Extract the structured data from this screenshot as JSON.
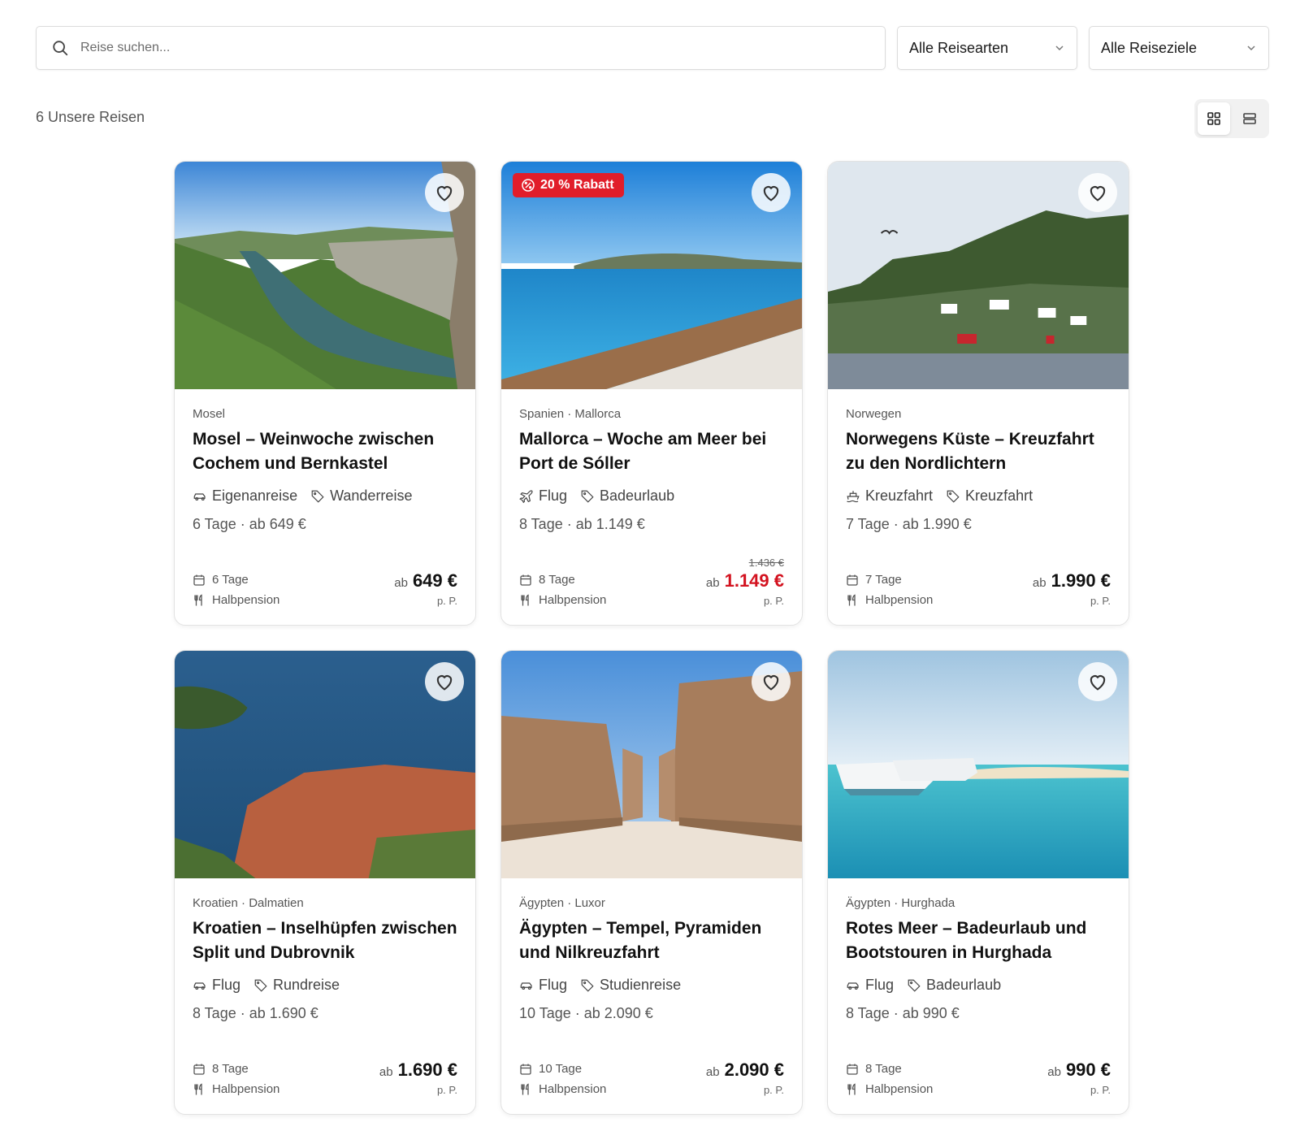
{
  "search": {
    "placeholder": "Reise suchen..."
  },
  "filters": {
    "type_label": "Alle Reisearten",
    "destination_label": "Alle Reiseziele"
  },
  "result_count": "6 Unsere Reisen",
  "view_modes": {
    "active": "grid",
    "options": [
      "grid-icon",
      "list-icon"
    ]
  },
  "colors": {
    "sale": "#d3121f",
    "badge": "#e11d2a",
    "border": "#e2e2e2"
  },
  "trips": [
    {
      "region": "Mosel",
      "title": "Mosel – Weinwoche zwischen Cochem und Bernkastel",
      "transport_icon": "car-icon",
      "transport": "Eigenanreise",
      "category": "Wanderreise",
      "summary": "6 Tage · ab 649 €",
      "duration": "6 Tage",
      "board": "Halbpension",
      "price_prefix": "ab",
      "price": "649 €",
      "old_price": "",
      "per_person": "p. P.",
      "badge": "",
      "image": "river-valley"
    },
    {
      "region": "Spanien · Mallorca",
      "title": "Mallorca – Woche am Meer bei Port de Sóller",
      "transport_icon": "plane-icon",
      "transport": "Flug",
      "category": "Badeurlaub",
      "summary": "8 Tage · ab 1.149 €",
      "duration": "8 Tage",
      "board": "Halbpension",
      "price_prefix": "ab",
      "price": "1.149 €",
      "old_price": "1.436 €",
      "per_person": "p. P.",
      "badge": "20 % Rabatt",
      "image": "bay"
    },
    {
      "region": "Norwegen",
      "title": "Norwegens Küste – Kreuzfahrt zu den Nordlichtern",
      "transport_icon": "ship-icon",
      "transport": "Kreuzfahrt",
      "category": "Kreuzfahrt",
      "summary": "7 Tage · ab 1.990 €",
      "duration": "7 Tage",
      "board": "Halbpension",
      "price_prefix": "ab",
      "price": "1.990 €",
      "old_price": "",
      "per_person": "p. P.",
      "badge": "",
      "image": "fjord"
    },
    {
      "region": "Kroatien · Dalmatien",
      "title": "Kroatien – Inselhüpfen zwischen Split und Dubrovnik",
      "transport_icon": "car-icon",
      "transport": "Flug",
      "category": "Rundreise",
      "summary": "8 Tage · ab 1.690 €",
      "duration": "8 Tage",
      "board": "Halbpension",
      "price_prefix": "ab",
      "price": "1.690 €",
      "old_price": "",
      "per_person": "p. P.",
      "badge": "",
      "image": "old-town-coast"
    },
    {
      "region": "Ägypten · Luxor",
      "title": "Ägypten – Tempel, Pyramiden und Nilkreuzfahrt",
      "transport_icon": "car-icon",
      "transport": "Flug",
      "category": "Studienreise",
      "summary": "10 Tage · ab 2.090 €",
      "duration": "10 Tage",
      "board": "Halbpension",
      "price_prefix": "ab",
      "price": "2.090 €",
      "old_price": "",
      "per_person": "p. P.",
      "badge": "",
      "image": "temple"
    },
    {
      "region": "Ägypten · Hurghada",
      "title": "Rotes Meer – Badeurlaub und Bootstouren in Hurghada",
      "transport_icon": "car-icon",
      "transport": "Flug",
      "category": "Badeurlaub",
      "summary": "8 Tage · ab 990 €",
      "duration": "8 Tage",
      "board": "Halbpension",
      "price_prefix": "ab",
      "price": "990 €",
      "old_price": "",
      "per_person": "p. P.",
      "badge": "",
      "image": "boats-lagoon"
    }
  ]
}
